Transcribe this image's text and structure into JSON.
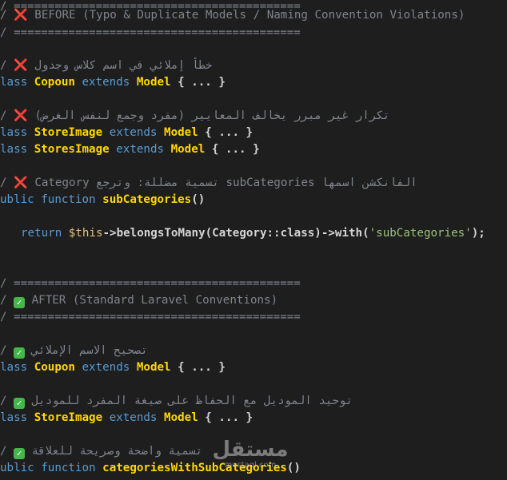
{
  "colors": {
    "background": "#1e1e1e",
    "comment": "#7f848e",
    "keyword": "#569cd6",
    "class_name": "#ffd700",
    "string": "#98c379",
    "error_icon": "#e0244a",
    "success_icon": "#45b649"
  },
  "icons": {
    "before": "cross-mark-icon",
    "after": "check-mark-icon"
  },
  "lines": {
    "l1": {
      "prefix": "/ ",
      "divider": "=========================================="
    },
    "l2": {
      "prefix": "/ ",
      "icon": "❌",
      "text": " BEFORE (Typo & Duplicate Models / Naming Convention Violations)"
    },
    "l3": {
      "prefix": "/ ",
      "divider": "=========================================="
    },
    "l4": {
      "prefix": "/ ",
      "icon": "❌",
      "arabic": "خطأ إملائي في اسم كلاس وجدول"
    },
    "l5": {
      "kw1": "lass",
      "cls": "Copoun",
      "kw2": "extends",
      "model": "Model",
      "body": "{ ... }"
    },
    "l6": {
      "prefix": "/ ",
      "icon": "❌",
      "arabic": "تكرار غير مبرر يخالف المعايير (مفرد وجمع لنفس الغرض)"
    },
    "l7": {
      "kw1": "lass",
      "cls": "StoreImage",
      "kw2": "extends",
      "model": "Model",
      "body": "{ ... }"
    },
    "l8": {
      "kw1": "lass",
      "cls": "StoresImage",
      "kw2": "extends",
      "model": "Model",
      "body": "{ ... }"
    },
    "l9": {
      "prefix": "/ ",
      "icon": "❌",
      "arabic": "الفانكشن اسمها subCategories تسمية مضللة: وترجع Category"
    },
    "l10": {
      "kw1": "ublic",
      "kw2": "function",
      "fn": "subCategories",
      "rest": "()"
    },
    "l11": {
      "kw": "return",
      "var": "$this",
      "mid": "->belongsToMany(Category::class)->with(",
      "str": "'subCategories'",
      "end": ");"
    },
    "l12": {
      "prefix": "/ ",
      "divider": "=========================================="
    },
    "l13": {
      "prefix": "/ ",
      "icon": "✓",
      "text": " AFTER (Standard Laravel Conventions)"
    },
    "l14": {
      "prefix": "/ ",
      "divider": "=========================================="
    },
    "l15": {
      "prefix": "/ ",
      "icon": "✓",
      "arabic": "تصحيح الاسم الإملائي"
    },
    "l16": {
      "kw1": "lass",
      "cls": "Coupon",
      "kw2": "extends",
      "model": "Model",
      "body": "{ ... }"
    },
    "l17": {
      "prefix": "/ ",
      "icon": "✓",
      "arabic": "توحيد الموديل مع الحفاظ على صيغة المفرد للموديل"
    },
    "l18": {
      "kw1": "lass",
      "cls": "StoreImage",
      "kw2": "extends",
      "model": "Model",
      "body": "{ ... }"
    },
    "l19": {
      "prefix": "/ ",
      "icon": "✓",
      "arabic": "تسمية واضحة وصريحة للعلاقة"
    },
    "l20": {
      "kw1": "ublic",
      "kw2": "function",
      "fn": "categoriesWithSubCategories",
      "rest": "()"
    }
  },
  "watermark": {
    "main": "مستقل",
    "sub": "mostaql.com"
  }
}
